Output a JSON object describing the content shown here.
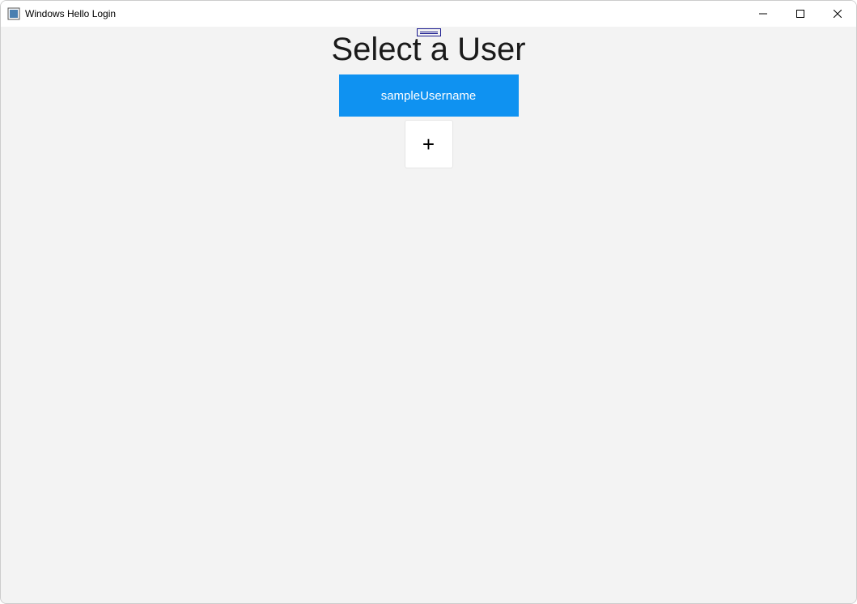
{
  "window": {
    "title": "Windows Hello Login"
  },
  "main": {
    "heading": "Select a User",
    "user_label": "sampleUsername",
    "add_label": "+"
  },
  "colors": {
    "accent": "#0f92f1",
    "background": "#f3f3f3"
  }
}
